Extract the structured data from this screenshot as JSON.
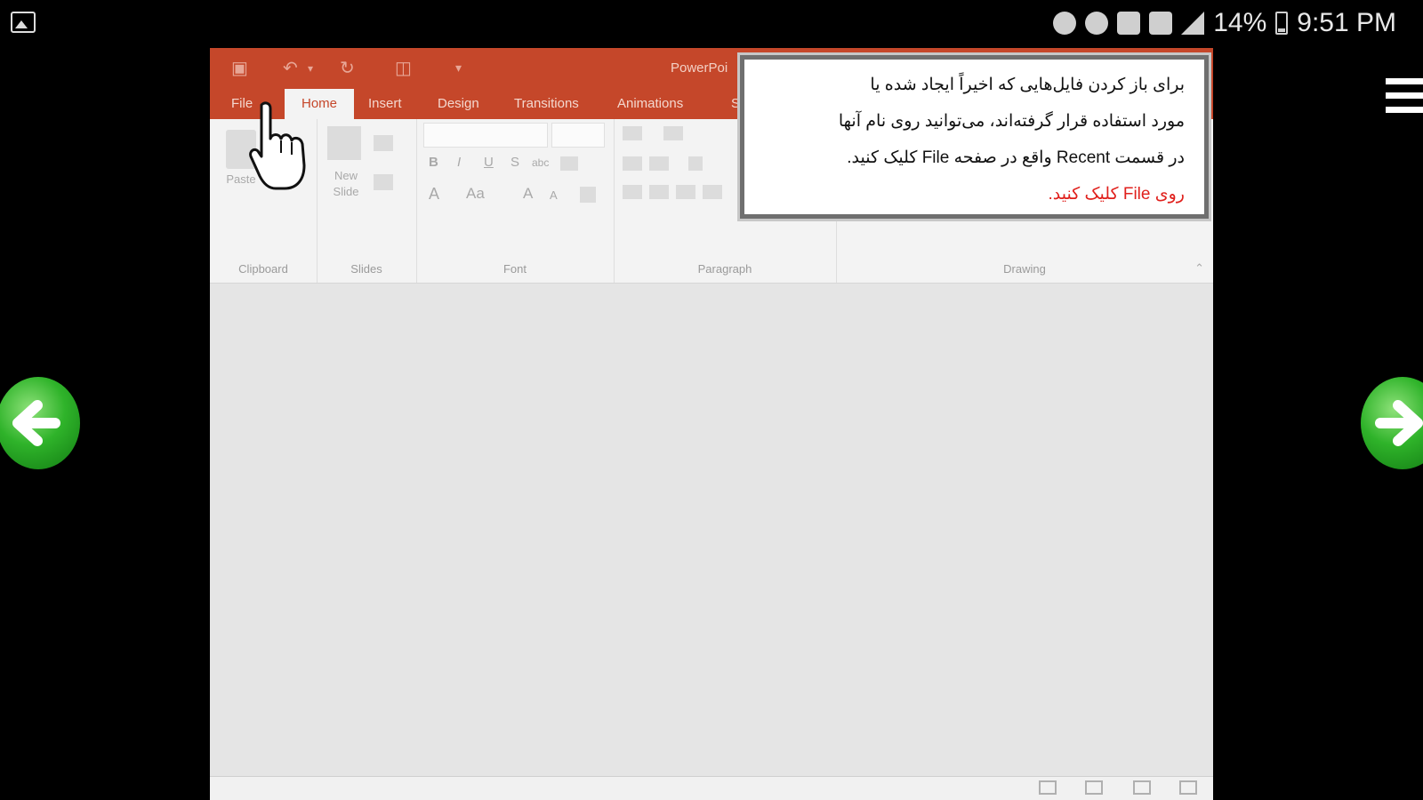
{
  "status_bar": {
    "battery": "14%",
    "time": "9:51 PM"
  },
  "powerpoint": {
    "title": "PowerPoi",
    "tabs": [
      {
        "label": "File"
      },
      {
        "label": "Home"
      },
      {
        "label": "Insert"
      },
      {
        "label": "Design"
      },
      {
        "label": "Transitions"
      },
      {
        "label": "Animations"
      },
      {
        "label": "S"
      }
    ],
    "ribbon": {
      "paste": "Paste",
      "new_slide_1": "New",
      "new_slide_2": "Slide",
      "groups": {
        "clipboard": "Clipboard",
        "slides": "Slides",
        "font": "Font",
        "paragraph": "Paragraph",
        "drawing": "Drawing"
      },
      "font_buttons": {
        "bold": "B",
        "italic": "I",
        "underline": "U",
        "strike": "S",
        "abc": "abc",
        "font_color": "A",
        "change_case": "Aa",
        "grow": "A",
        "shrink": "A"
      }
    }
  },
  "callout": {
    "line1": "برای باز کردن فایل‌هایی که اخیراً ایجاد شده یا",
    "line2": "مورد استفاده قرار گرفته‌اند، می‌توانید روی نام آنها",
    "line3": "در قسمت Recent واقع در صفحه File کلیک کنید.",
    "line4": "روی File کلیک کنید."
  },
  "colors": {
    "ribbon_accent": "#c5472a",
    "callout_highlight": "#e0201c",
    "nav_button": "#2fb32a"
  }
}
